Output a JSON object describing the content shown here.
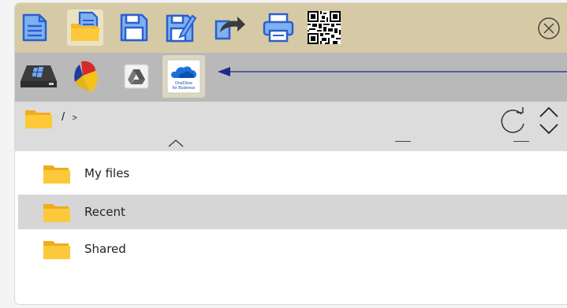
{
  "toolbar": {
    "buttons": [
      {
        "name": "new-file-icon"
      },
      {
        "name": "open-file-icon",
        "active": true
      },
      {
        "name": "save-icon"
      },
      {
        "name": "save-as-icon"
      },
      {
        "name": "share-icon"
      },
      {
        "name": "print-icon"
      },
      {
        "name": "qr-code-icon"
      }
    ],
    "close_icon": "close-icon"
  },
  "storage": {
    "providers": [
      {
        "name": "local-drive-icon"
      },
      {
        "name": "colored-flag-icon"
      },
      {
        "name": "google-drive-icon"
      },
      {
        "name": "onedrive-business-icon",
        "label_line1": "OneDrive",
        "label_line2": "for Business",
        "active": true
      }
    ]
  },
  "path": {
    "root": "/",
    "separator": ">"
  },
  "files": {
    "items": [
      {
        "label": "My files"
      },
      {
        "label": "Recent",
        "selected": true
      },
      {
        "label": "Shared"
      }
    ]
  },
  "colors": {
    "toolbar_bg": "#d6caa6",
    "storebar_bg": "#b9b9b9",
    "pathbar_bg": "#dcdcdc",
    "accent_blue": "#2a5fd0",
    "folder_yellow": "#f7b928",
    "selected_row": "#d6d6d6"
  }
}
